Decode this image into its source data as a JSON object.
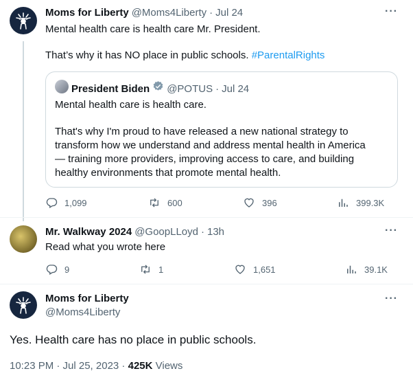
{
  "tweet1": {
    "name": "Moms for Liberty",
    "handle": "@Moms4Liberty",
    "sep": "·",
    "date": "Jul 24",
    "line1": "Mental health care is health care Mr. President.",
    "line2": "That’s why it has NO place in public schools.",
    "hashtag": "#ParentalRights",
    "quote": {
      "name": "President Biden",
      "handle": "@POTUS",
      "sep": "·",
      "date": "Jul 24",
      "line1": "Mental health care is health care.",
      "p2_l1": "That's why I'm proud to have released a new national strategy to",
      "p2_l2": "transform how we understand and address mental health in America",
      "p2_l3": "— training more providers, improving access to care, and building",
      "p2_l4": "healthy environments that promote mental health."
    },
    "replies": "1,099",
    "reposts": "600",
    "likes": "396",
    "views": "399.3K"
  },
  "tweet2": {
    "name": "Mr. Walkway 2024",
    "handle": "@GoopLLoyd",
    "sep": "·",
    "date": "13h",
    "text": "Read what you wrote here",
    "replies": "9",
    "reposts": "1",
    "likes": "1,651",
    "views": "39.1K"
  },
  "tweet3": {
    "name": "Moms for Liberty",
    "handle": "@Moms4Liberty",
    "text": "Yes. Health care  has no place in public schools.",
    "time": "10:23 PM · Jul 25, 2023 · ",
    "views_count": "425K",
    "views_label": " Views"
  },
  "more_label": "···",
  "icons": [
    "reply-icon",
    "repost-icon",
    "like-icon",
    "views-icon",
    "verified-badge-icon",
    "more-icon"
  ],
  "colors": {
    "accent": "#1d9bf0",
    "muted": "#536471",
    "border": "#cfd9de",
    "text": "#0f1419"
  }
}
